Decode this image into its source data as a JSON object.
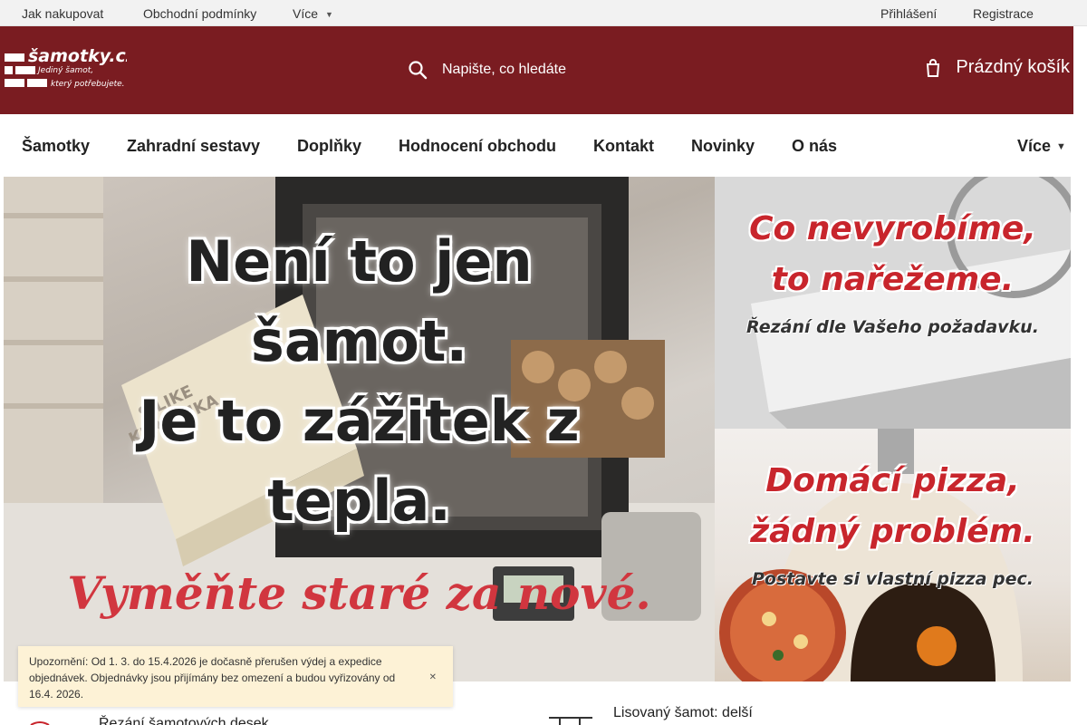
{
  "topbar": {
    "links": [
      "Jak nakupovat",
      "Obchodní podmínky",
      "Více"
    ],
    "login": "Přihlášení",
    "register": "Registrace"
  },
  "header": {
    "logo": {
      "name": "šamotky.cz",
      "slogan_line1": "Jediný šamot,",
      "slogan_line2": "který potřebujete."
    },
    "search_placeholder": "Napište, co hledáte",
    "cart_label": "Prázdný košík",
    "colors": {
      "brand": "#7a1c21",
      "topbar": "#f2f2f2",
      "notice": "#fdf2d6"
    }
  },
  "nav": {
    "items": [
      "Šamotky",
      "Zahradní sestavy",
      "Doplňky",
      "Hodnocení obchodu",
      "Kontakt",
      "Novinky",
      "O nás"
    ],
    "more": "Více"
  },
  "banners": {
    "main": {
      "line1": "Není to jen",
      "line2": "šamot.",
      "line3": "Je to zážitek z",
      "line4": "tepla.",
      "tagline": "Vyměňte staré za nové.",
      "brick_text1": "SILIKE",
      "brick_text2": "KERAMIKA"
    },
    "top": {
      "line1": "Co nevyrobíme,",
      "line2": "to nařežeme.",
      "subline": "Řezání dle Vašeho požadavku."
    },
    "bottom": {
      "line1": "Domácí pizza,",
      "line2": "žádný problém.",
      "subline": "Postavte si vlastní pizza pec."
    }
  },
  "notice": {
    "text": "Upozornění: Od 1. 3. do 15.4.2026 je dočasně přerušen výdej a expedice objednávek. Objednávky jsou přijímány bez omezení a budou vyřizovány od 16.4. 2026."
  },
  "features": {
    "cutting": "Řezání šamotových desek",
    "pressed": "Lisovaný šamot: delší"
  },
  "icons": [
    "search-icon",
    "cart-icon",
    "chevron-down-icon",
    "close-icon",
    "cutting-icon",
    "pressed-brick-icon"
  ]
}
